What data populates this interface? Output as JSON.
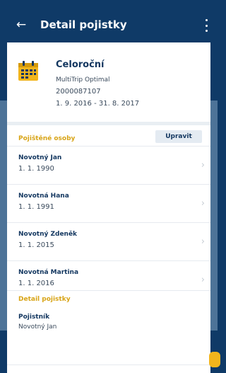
{
  "app_bar": {
    "title": "Detail pojistky",
    "back_icon": "arrow-left-icon",
    "menu_icon": "more-vertical-icon"
  },
  "policy": {
    "icon": "calendar-icon",
    "plan_name": "Celoroční",
    "product": "MultiTrip Optimal",
    "number": "2000087107",
    "validity": "1. 9. 2016 - 31. 8. 2017"
  },
  "insured": {
    "section_label": "Pojištěné osoby",
    "edit_label": "Upravit",
    "persons": [
      {
        "name": "Novotný Jan",
        "dob": "1. 1. 1990"
      },
      {
        "name": "Novotná Hana",
        "dob": "1. 1. 1991"
      },
      {
        "name": "Novotný Zdeněk",
        "dob": "1. 1. 2015"
      },
      {
        "name": "Novotná Martina",
        "dob": "1. 1. 2016"
      }
    ]
  },
  "details": {
    "section_label": "Detail pojistky",
    "holder_label": "Pojistník",
    "holder_value": "Novotný Jan"
  },
  "colors": {
    "header_bg": "#0f3a67",
    "accent": "#d8a416",
    "text_primary": "#12365f",
    "fab": "#f2b51c"
  }
}
